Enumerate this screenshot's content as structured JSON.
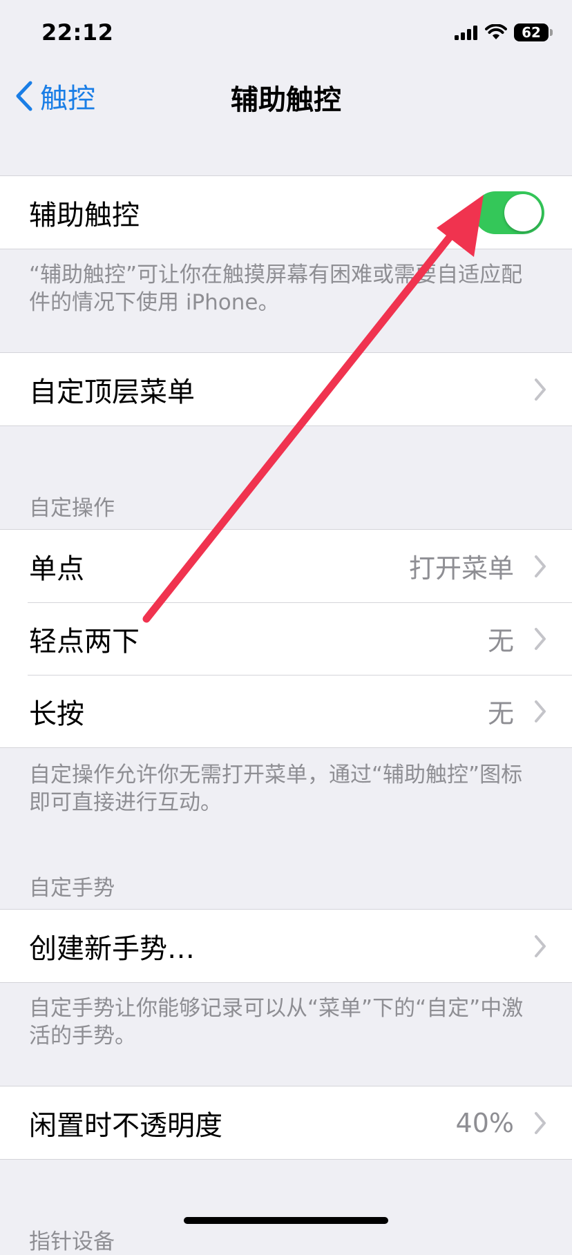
{
  "status_bar": {
    "time": "22:12",
    "battery": "62"
  },
  "nav": {
    "back_label": "触控",
    "title": "辅助触控"
  },
  "assistive_touch": {
    "label": "辅助触控",
    "enabled": true,
    "footnote": "“辅助触控”可让你在触摸屏幕有困难或需要自适应配件的情况下使用 iPhone。"
  },
  "top_menu": {
    "label": "自定顶层菜单"
  },
  "custom_actions": {
    "header": "自定操作",
    "items": [
      {
        "label": "单点",
        "value": "打开菜单"
      },
      {
        "label": "轻点两下",
        "value": "无"
      },
      {
        "label": "长按",
        "value": "无"
      }
    ],
    "footnote": "自定操作允许你无需打开菜单，通过“辅助触控”图标即可直接进行互动。"
  },
  "custom_gestures": {
    "header": "自定手势",
    "create_label": "创建新手势…",
    "footnote": "自定手势让你能够记录可以从“菜单”下的“自定”中激活的手势。"
  },
  "idle_opacity": {
    "label": "闲置时不透明度",
    "value": "40%"
  },
  "pointer_devices": {
    "header": "指针设备"
  },
  "colors": {
    "toggle_on": "#34c759",
    "link": "#1a7ee6",
    "annotation_arrow": "#f0334f"
  }
}
